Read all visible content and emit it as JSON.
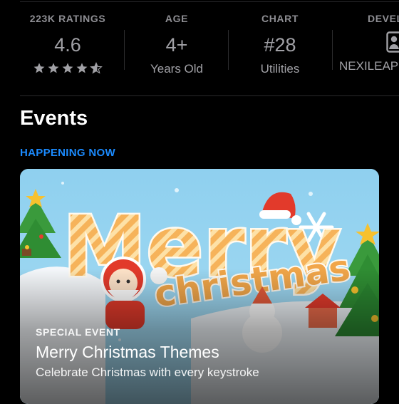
{
  "stats": [
    {
      "label": "223K RATINGS",
      "value": "4.6",
      "rating": 4.6
    },
    {
      "label": "AGE",
      "value": "4+",
      "sub": "Years Old"
    },
    {
      "label": "CHART",
      "value": "#28",
      "sub": "Utilities"
    },
    {
      "label": "DEVEL",
      "sub": "NEXILEAP",
      "icon": "developer-person-icon"
    }
  ],
  "section": {
    "title": "Events",
    "eyebrow": "HAPPENING NOW"
  },
  "event_card": {
    "tag": "SPECIAL EVENT",
    "title": "Merry Christmas Themes",
    "subtitle": "Celebrate Christmas with every keystroke",
    "art_text_1": "Merry",
    "art_text_2": "christmas"
  },
  "colors": {
    "accent": "#1b8bff",
    "background": "#000000",
    "muted": "#8e8e93"
  }
}
